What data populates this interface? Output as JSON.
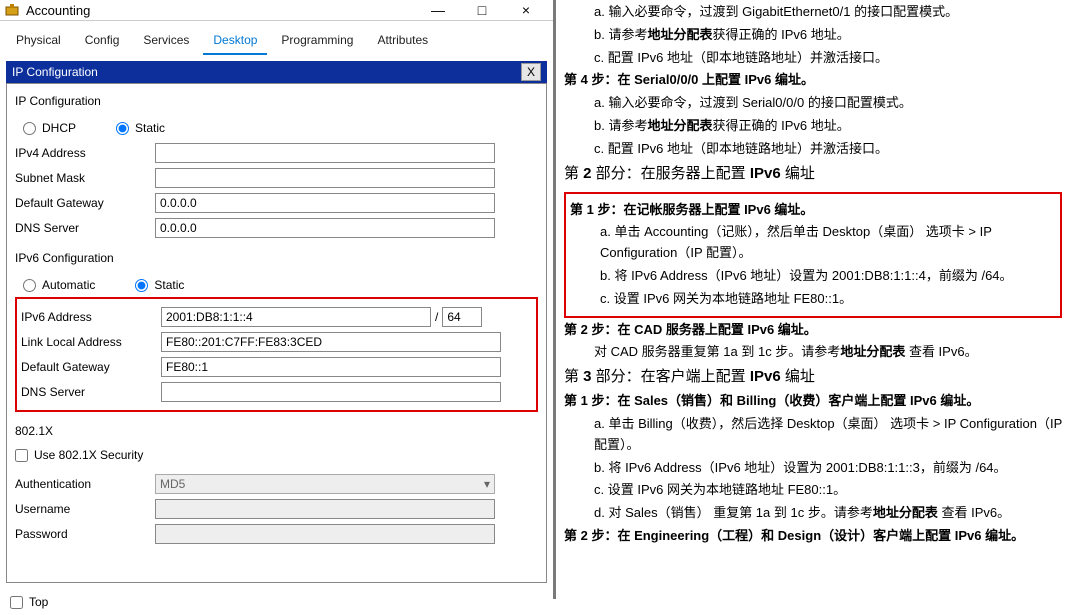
{
  "window": {
    "title": "Accounting",
    "minimize": "—",
    "maximize": "□",
    "close": "×"
  },
  "tabs": [
    "Physical",
    "Config",
    "Services",
    "Desktop",
    "Programming",
    "Attributes"
  ],
  "active_tab": 3,
  "panel_header": "IP Configuration",
  "close_x": "X",
  "ipconf": {
    "section": "IP Configuration",
    "dhcp": "DHCP",
    "static": "Static",
    "ipv4_addr_label": "IPv4 Address",
    "ipv4_addr": "",
    "subnet_label": "Subnet Mask",
    "subnet": "",
    "gateway_label": "Default Gateway",
    "gateway": "0.0.0.0",
    "dns_label": "DNS Server",
    "dns": "0.0.0.0"
  },
  "ipv6conf": {
    "section": "IPv6 Configuration",
    "auto": "Automatic",
    "static": "Static",
    "addr_label": "IPv6 Address",
    "addr": "2001:DB8:1:1::4",
    "prefix": "64",
    "linklocal_label": "Link Local Address",
    "linklocal": "FE80::201:C7FF:FE83:3CED",
    "gateway_label": "Default Gateway",
    "gateway": "FE80::1",
    "dns_label": "DNS Server",
    "dns": ""
  },
  "dot1x": {
    "section": "802.1X",
    "use_label": "Use 802.1X Security",
    "auth_label": "Authentication",
    "auth_value": "MD5",
    "user_label": "Username",
    "pass_label": "Password"
  },
  "footer": {
    "top": "Top"
  },
  "doc": {
    "l0a": "a. 输入必要命令，过渡到 GigabitEthernet0/1 的接口配置模式。",
    "l0b_pre": "b. 请参考",
    "l0b_bold": "地址分配表",
    "l0b_post": "获得正确的 IPv6 地址。",
    "l0c": "c. 配置 IPv6 地址（即本地链路地址）并激活接口。",
    "step4": "第 4 步：在 Serial0/0/0 上配置 IPv6 编址。",
    "s4a": "a. 输入必要命令，过渡到 Serial0/0/0 的接口配置模式。",
    "s4b_pre": "b. 请参考",
    "s4b_bold": "地址分配表",
    "s4b_post": "获得正确的 IPv6 地址。",
    "s4c": "c. 配置 IPv6 地址（即本地链路地址）并激活接口。",
    "part2": "第 2 部分：在服务器上配置 IPv6 编址",
    "p2s1": "第 1 步：在记帐服务器上配置 IPv6 编址。",
    "p2s1a": "a. 单击 Accounting（记账），然后单击 Desktop（桌面） 选项卡 > IP Configuration（IP 配置）。",
    "p2s1b": "b. 将 IPv6 Address（IPv6 地址）设置为 2001:DB8:1:1::4，前缀为 /64。",
    "p2s1c": "c. 设置 IPv6 网关为本地链路地址 FE80::1。",
    "p2s2": "第 2 步：在 CAD 服务器上配置 IPv6 编址。",
    "p2s2a_pre": "对 CAD 服务器重复第 1a 到 1c 步。请参考",
    "p2s2a_bold": "地址分配表",
    "p2s2a_post": " 查看 IPv6。",
    "part3": "第 3 部分：在客户端上配置 IPv6 编址",
    "p3s1": "第 1 步：在 Sales（销售）和 Billing（收费）客户端上配置 IPv6 编址。",
    "p3s1a": "a. 单击 Billing（收费），然后选择 Desktop（桌面） 选项卡 > IP Configuration（IP 配置）。",
    "p3s1b": "b. 将 IPv6 Address（IPv6 地址）设置为 2001:DB8:1:1::3，前缀为 /64。",
    "p3s1c": "c. 设置 IPv6 网关为本地链路地址 FE80::1。",
    "p3s1d_pre": "d. 对 Sales（销售） 重复第 1a 到 1c 步。请参考",
    "p3s1d_bold": "地址分配表",
    "p3s1d_post": " 查看 IPv6。",
    "p3s2": "第 2 步：在 Engineering（工程）和 Design（设计）客户端上配置 IPv6 编址。"
  }
}
